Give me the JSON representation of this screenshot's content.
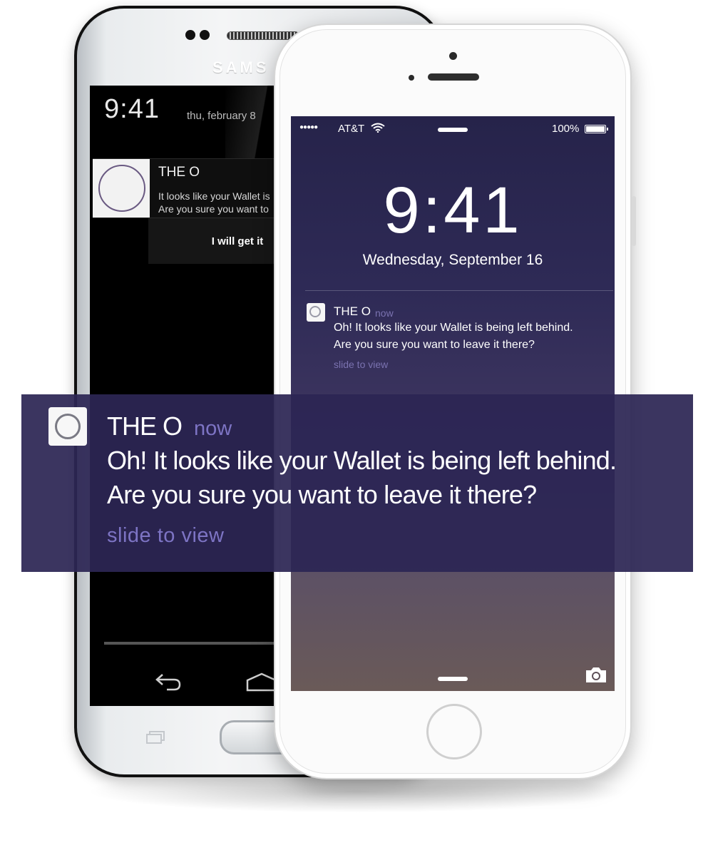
{
  "samsung": {
    "brand": "SAMS",
    "lock": {
      "time": "9:41",
      "date": "thu, february 8"
    },
    "notification": {
      "title": "THE O",
      "line1": "It looks like your Wallet is",
      "line2": "Are you sure you want to",
      "action_label": "I will get it"
    },
    "nav": {
      "back_icon": "back-arrow-icon",
      "home_icon": "home-icon",
      "recent_icon": "recent-apps-icon"
    }
  },
  "iphone": {
    "status": {
      "signal": "●●●●●",
      "carrier": "AT&T",
      "battery": "100%"
    },
    "lock": {
      "time": "9:41",
      "date": "Wednesday, September 16"
    },
    "notification": {
      "title": "THE O",
      "time": "now",
      "line1": "Oh! It looks like your Wallet is being left behind.",
      "line2": "Are you sure you want to leave it there?",
      "slide": "slide to view"
    }
  },
  "banner": {
    "title": "THE O",
    "time": "now",
    "line1": "Oh! It looks like your Wallet is being left behind.",
    "line2": "Are you sure you want to leave it there?",
    "slide": "slide to view"
  },
  "colors": {
    "banner_bg": "#2c2654",
    "accent_muted": "#7d74c4",
    "samsung_screen": "#000000",
    "iphone_wallpaper_top": "#26234a",
    "iphone_wallpaper_bottom": "#6a5a58"
  }
}
